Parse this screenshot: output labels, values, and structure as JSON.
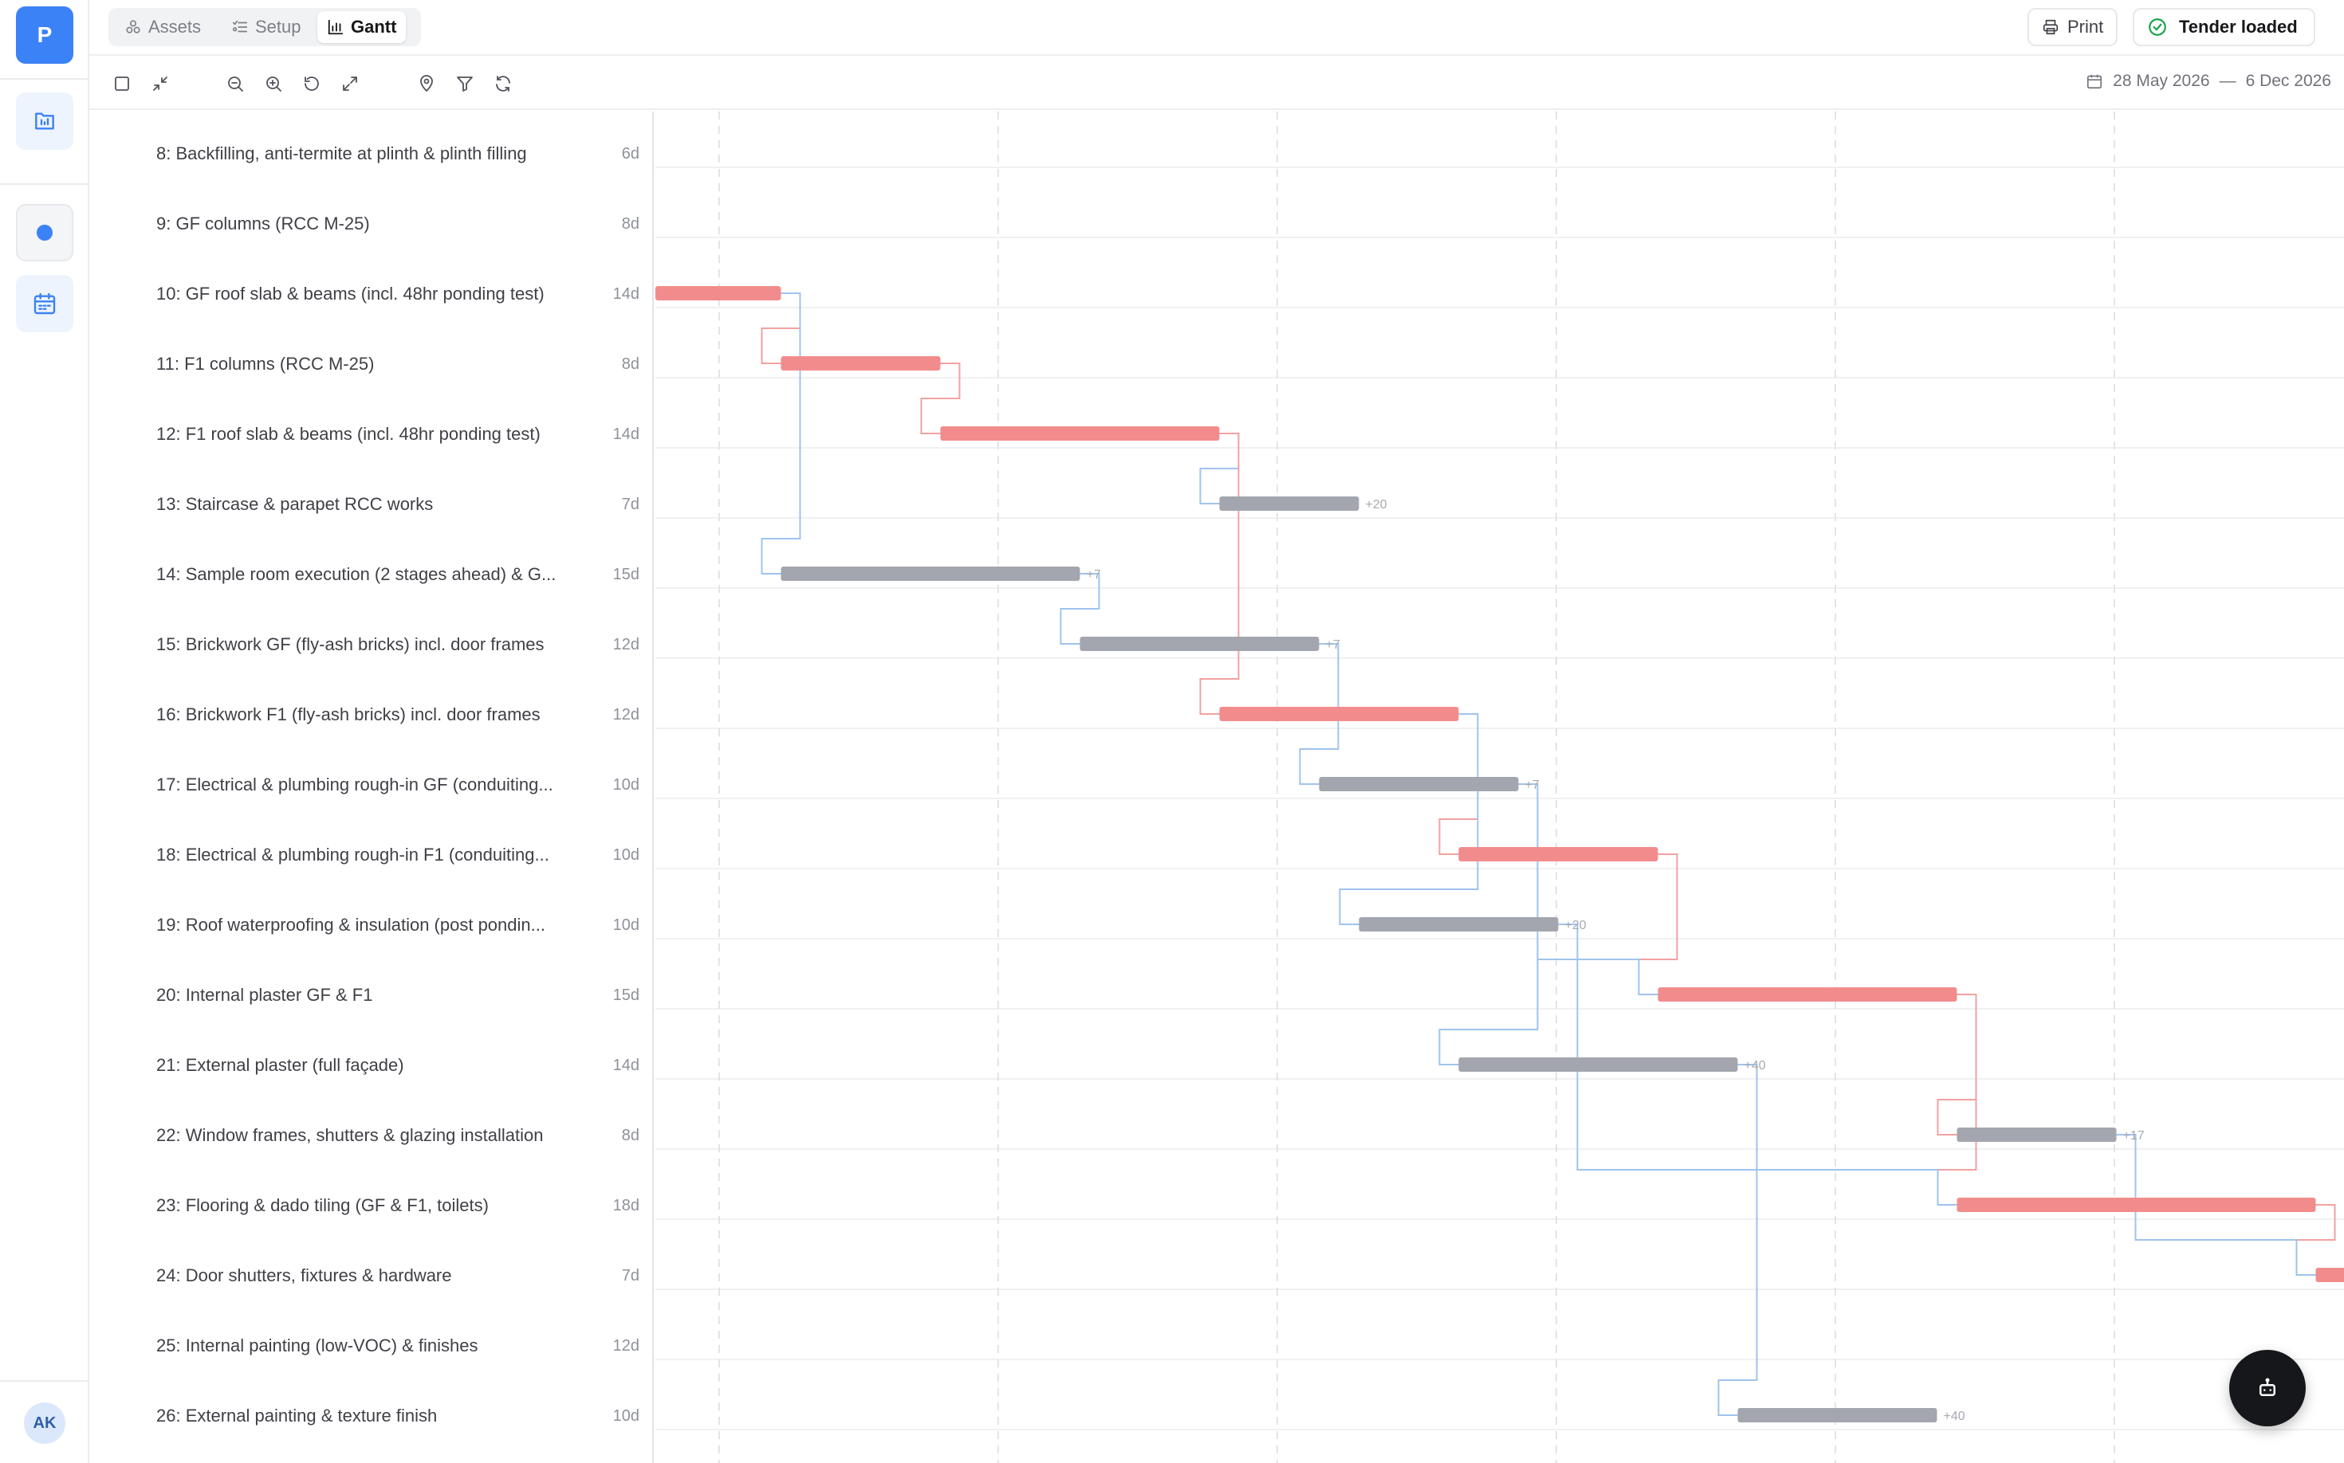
{
  "rail": {
    "logo_letter": "P",
    "avatar_initials": "AK",
    "accent": "#3b82f6"
  },
  "tabs": [
    {
      "label": "Assets",
      "icon": "assets-icon"
    },
    {
      "label": "Setup",
      "icon": "list-settings-icon"
    },
    {
      "label": "Gantt",
      "icon": "bar-chart-icon",
      "active": true
    }
  ],
  "header": {
    "print_label": "Print",
    "tender_status": "Tender loaded"
  },
  "toolbar": {
    "tools": [
      "select-checkbox-icon",
      "collapse-icon",
      "zoom-out-icon",
      "zoom-in-icon",
      "reset-icon",
      "expand-icon",
      "map-pin-icon",
      "filter-icon",
      "refresh-icon"
    ],
    "date_start": "28 May 2026",
    "date_sep": "—",
    "date_end": "6 Dec 2026"
  },
  "colors": {
    "critical": "#f28c8c",
    "normal": "#a3a6ae",
    "link_critical": "#f2a1a1",
    "link_normal": "#9fc3ee"
  },
  "tasks": [
    {
      "name": "8: Backfilling, anti-termite at plinth & plinth filling",
      "duration": "6d"
    },
    {
      "name": "9: GF columns (RCC M-25)",
      "duration": "8d"
    },
    {
      "name": "10: GF roof slab & beams (incl. 48hr ponding test)",
      "duration": "14d"
    },
    {
      "name": "11: F1 columns (RCC M-25)",
      "duration": "8d"
    },
    {
      "name": "12: F1 roof slab & beams (incl. 48hr ponding test)",
      "duration": "14d"
    },
    {
      "name": "13: Staircase & parapet RCC works",
      "duration": "7d"
    },
    {
      "name": "14: Sample room execution (2 stages ahead) & G...",
      "duration": "15d"
    },
    {
      "name": "15: Brickwork GF (fly-ash bricks) incl. door frames",
      "duration": "12d"
    },
    {
      "name": "16: Brickwork F1 (fly-ash bricks) incl. door frames",
      "duration": "12d"
    },
    {
      "name": "17: Electrical & plumbing rough-in GF (conduiting...",
      "duration": "10d"
    },
    {
      "name": "18: Electrical & plumbing rough-in F1 (conduiting...",
      "duration": "10d"
    },
    {
      "name": "19: Roof waterproofing & insulation (post pondin...",
      "duration": "10d"
    },
    {
      "name": "20: Internal plaster GF & F1",
      "duration": "15d"
    },
    {
      "name": "21: External plaster (full façade)",
      "duration": "14d"
    },
    {
      "name": "22: Window frames, shutters & glazing installation",
      "duration": "8d"
    },
    {
      "name": "23: Flooring & dado tiling (GF & F1, toilets)",
      "duration": "18d"
    },
    {
      "name": "24: Door shutters, fixtures & hardware",
      "duration": "7d"
    },
    {
      "name": "25: Internal painting (low-VOC) & finishes",
      "duration": "12d"
    },
    {
      "name": "26: External painting & texture finish",
      "duration": "10d"
    }
  ],
  "bars": [
    {
      "row": 2,
      "start": 0,
      "len": 6.3,
      "critical": true
    },
    {
      "row": 3,
      "start": 6.3,
      "len": 8,
      "critical": true
    },
    {
      "row": 4,
      "start": 14.3,
      "len": 14,
      "critical": true
    },
    {
      "row": 5,
      "start": 28.3,
      "len": 7,
      "critical": false,
      "slack": "+20"
    },
    {
      "row": 6,
      "start": 6.3,
      "len": 15,
      "critical": false,
      "slack": "+7"
    },
    {
      "row": 7,
      "start": 21.3,
      "len": 12,
      "critical": false,
      "slack": "+7"
    },
    {
      "row": 8,
      "start": 28.3,
      "len": 12,
      "critical": true
    },
    {
      "row": 9,
      "start": 33.3,
      "len": 10,
      "critical": false,
      "slack": "+7"
    },
    {
      "row": 10,
      "start": 40.3,
      "len": 10,
      "critical": true
    },
    {
      "row": 11,
      "start": 35.3,
      "len": 10,
      "critical": false,
      "slack": "+20"
    },
    {
      "row": 12,
      "start": 50.3,
      "len": 15,
      "critical": true
    },
    {
      "row": 13,
      "start": 40.3,
      "len": 14,
      "critical": false,
      "slack": "+40"
    },
    {
      "row": 14,
      "start": 65.3,
      "len": 8,
      "critical": false,
      "slack": "+17"
    },
    {
      "row": 15,
      "start": 65.3,
      "len": 18,
      "critical": true
    },
    {
      "row": 16,
      "start": 83.3,
      "len": 7,
      "critical": true
    },
    {
      "row": 18,
      "start": 54.3,
      "len": 10,
      "critical": false,
      "slack": "+40"
    }
  ],
  "links": [
    {
      "from": 2,
      "to": 3,
      "critical": true
    },
    {
      "from": 3,
      "to": 4,
      "critical": true
    },
    {
      "from": 4,
      "to": 5,
      "critical": false
    },
    {
      "from": 2,
      "to": 6,
      "critical": false
    },
    {
      "from": 6,
      "to": 7,
      "critical": false
    },
    {
      "from": 4,
      "to": 8,
      "critical": true
    },
    {
      "from": 7,
      "to": 9,
      "critical": false
    },
    {
      "from": 8,
      "to": 10,
      "critical": true
    },
    {
      "from": 8,
      "to": 11,
      "critical": false
    },
    {
      "from": 10,
      "to": 12,
      "critical": true
    },
    {
      "from": 9,
      "to": 12,
      "critical": false
    },
    {
      "from": 9,
      "to": 13,
      "critical": false
    },
    {
      "from": 12,
      "to": 14,
      "critical": true
    },
    {
      "from": 12,
      "to": 15,
      "critical": true
    },
    {
      "from": 11,
      "to": 15,
      "critical": false
    },
    {
      "from": 15,
      "to": 16,
      "critical": true
    },
    {
      "from": 14,
      "to": 16,
      "critical": false
    },
    {
      "from": 13,
      "to": 18,
      "critical": false
    }
  ]
}
